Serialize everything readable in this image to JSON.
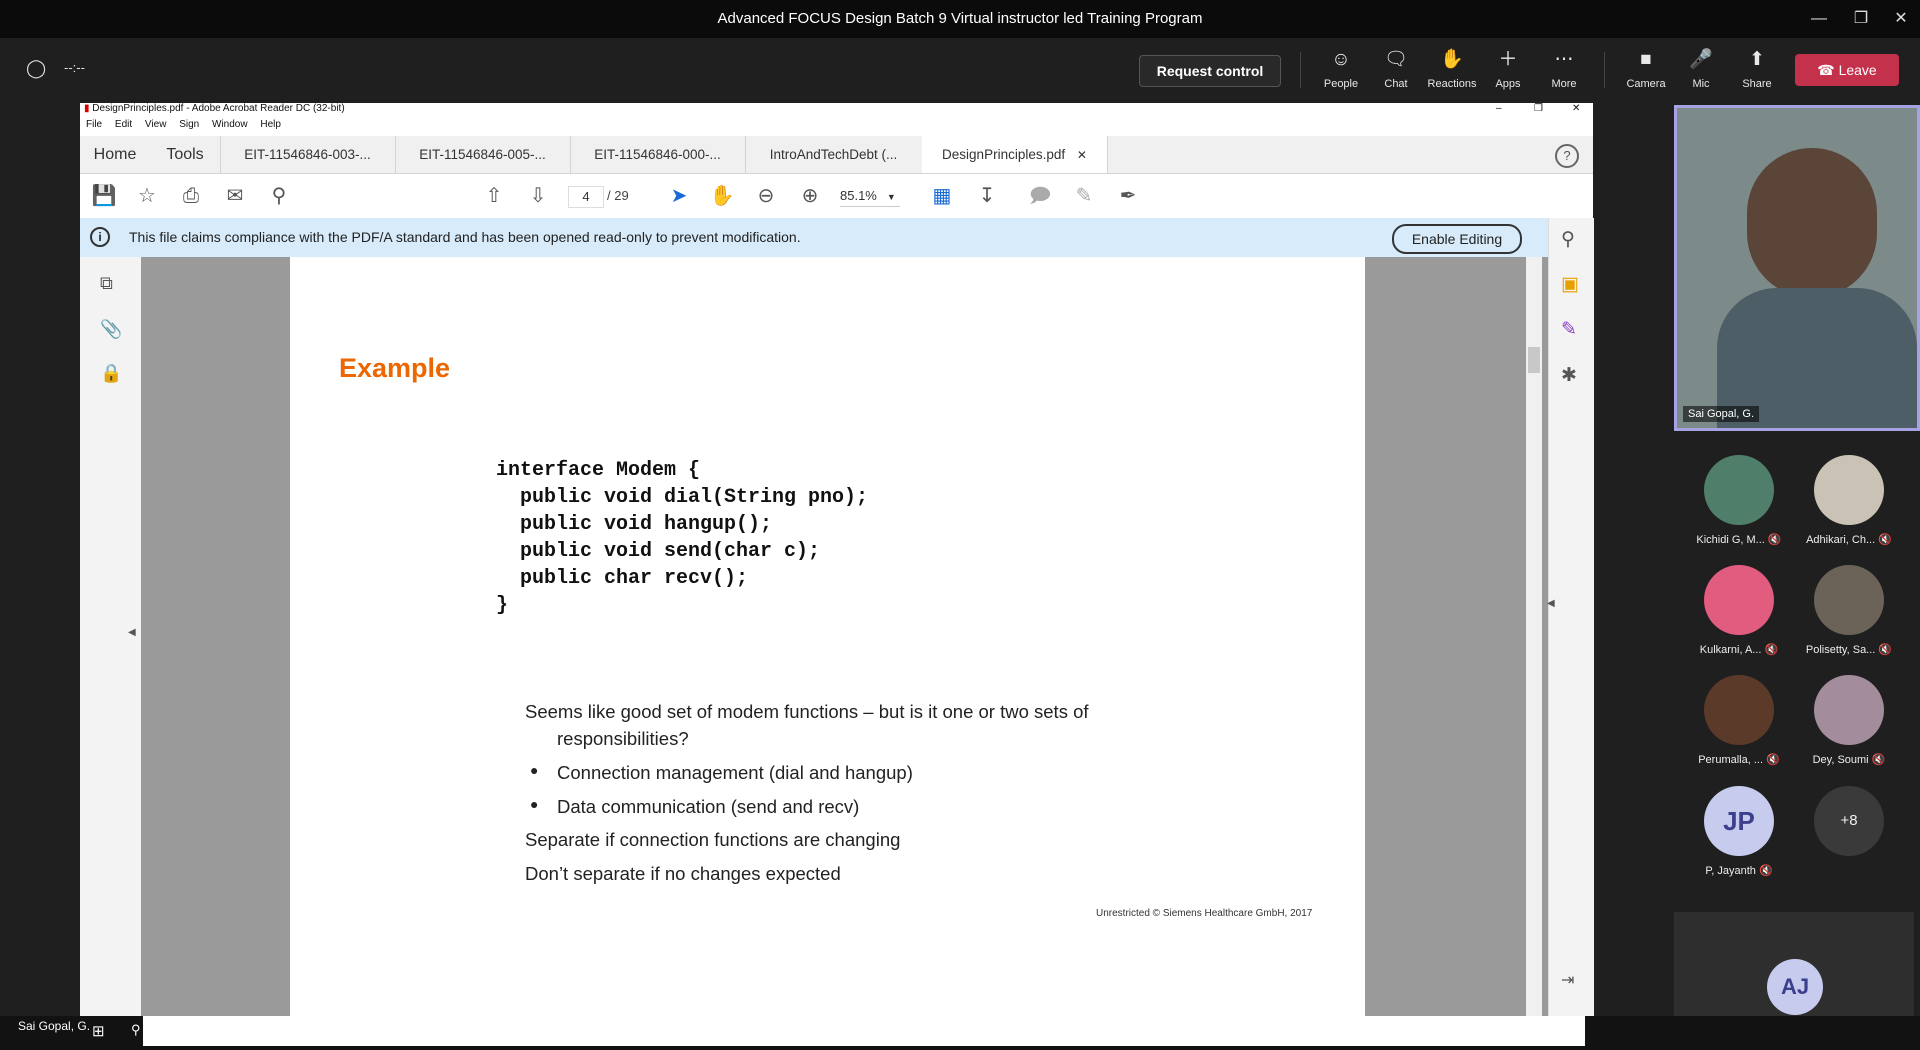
{
  "teams": {
    "window_title": "Advanced FOCUS Design Batch 9 Virtual instructor led Training Program",
    "timer": "--:--",
    "request_control": "Request control",
    "buttons": {
      "people": "People",
      "chat": "Chat",
      "reactions": "Reactions",
      "apps": "Apps",
      "more": "More",
      "camera": "Camera",
      "mic": "Mic",
      "share": "Share",
      "leave": "Leave"
    }
  },
  "acrobat": {
    "title": "DesignPrinciples.pdf - Adobe Acrobat Reader DC (32-bit)",
    "menu": [
      "File",
      "Edit",
      "View",
      "Sign",
      "Window",
      "Help"
    ],
    "home": "Home",
    "tools": "Tools",
    "tabs": [
      "EIT-11546846-003-...",
      "EIT-11546846-005-...",
      "EIT-11546846-000-...",
      "IntroAndTechDebt (...",
      "DesignPrinciples.pdf"
    ],
    "page_current": "4",
    "page_total": "/ 29",
    "zoom": "85.1%",
    "banner_text": "This file claims compliance with the PDF/A standard and has been opened read-only to prevent modification.",
    "enable_editing": "Enable Editing"
  },
  "slide": {
    "heading": "Example",
    "code": "interface Modem {\n  public void dial(String pno);\n  public void hangup();\n  public void send(char c);\n  public char recv();\n}",
    "q_line1": "Seems like good set of modem functions – but is it one or two sets of",
    "q_line2": "responsibilities?",
    "bullet1": "Connection management (dial and hangup)",
    "bullet2": "Data communication (send and recv)",
    "line_sep": "Separate if connection functions are changing",
    "line_dont": "Don’t separate if no changes expected",
    "footer": "Unrestricted © Siemens Healthcare GmbH, 2017"
  },
  "participants": {
    "self_name": "Sai Gopal, G.",
    "list": [
      {
        "name": "Kichidi G, M...",
        "initials": ""
      },
      {
        "name": "Adhikari, Ch...",
        "initials": ""
      },
      {
        "name": "Kulkarni, A...",
        "initials": ""
      },
      {
        "name": "Polisetty, Sa...",
        "initials": ""
      },
      {
        "name": "Perumalla, ...",
        "initials": ""
      },
      {
        "name": "Dey, Soumi",
        "initials": ""
      },
      {
        "name": "P, Jayanth",
        "initials": "JP"
      },
      {
        "name": "",
        "initials": "+8"
      }
    ],
    "bottom_initials": "AJ"
  },
  "presenter_label": "Sai Gopal, G.",
  "colors": {
    "leave": "#c4314b",
    "heading": "#ec6602",
    "banner": "#d7ebfa",
    "avatar_border": "#a7a2e3"
  }
}
